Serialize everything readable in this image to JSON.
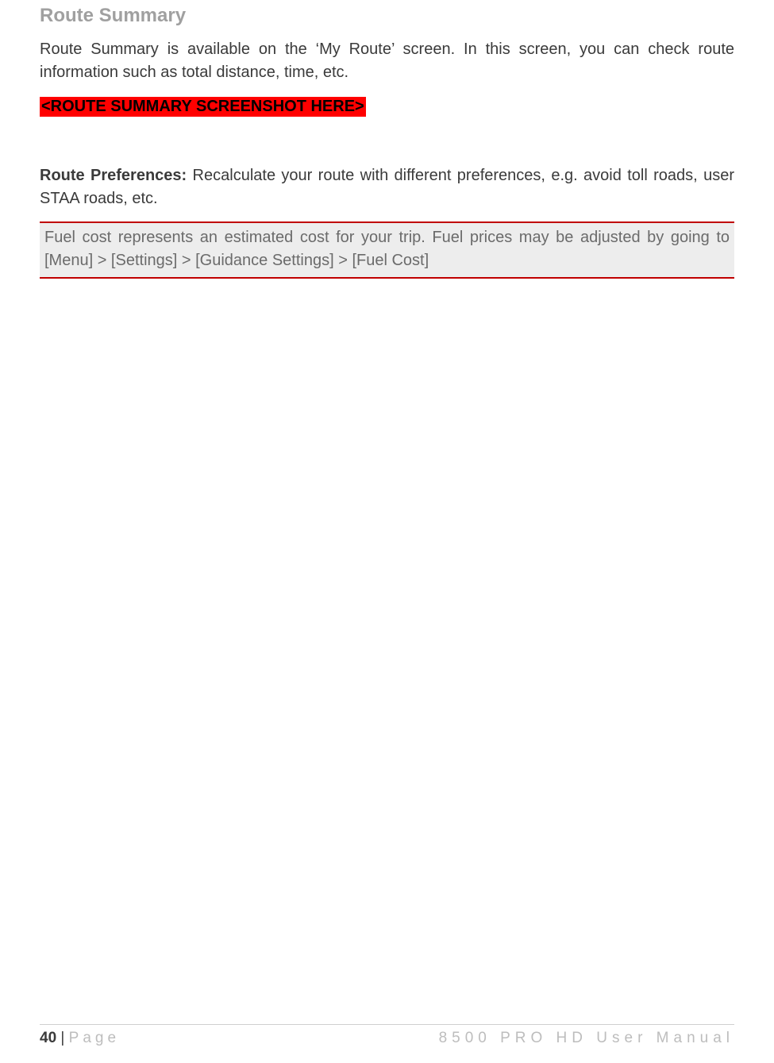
{
  "heading": "Route Summary",
  "intro": "Route Summary is available on the ‘My Route’ screen. In this screen, you can check route information such as total distance, time, etc.",
  "placeholder": "<ROUTE SUMMARY SCREENSHOT HERE>",
  "prefs_label": "Route Preferences:",
  "prefs_text": "  Recalculate your route with different preferences, e.g. avoid toll roads, user STAA roads, etc.",
  "note": "Fuel cost represents an estimated cost for your trip. Fuel prices may be adjusted by going to [Menu] > [Settings] > [Guidance Settings] > [Fuel Cost]",
  "footer": {
    "page_number": "40",
    "sep": " | ",
    "page_word": "Page",
    "doc_title": "8500 PRO HD User Manual"
  }
}
